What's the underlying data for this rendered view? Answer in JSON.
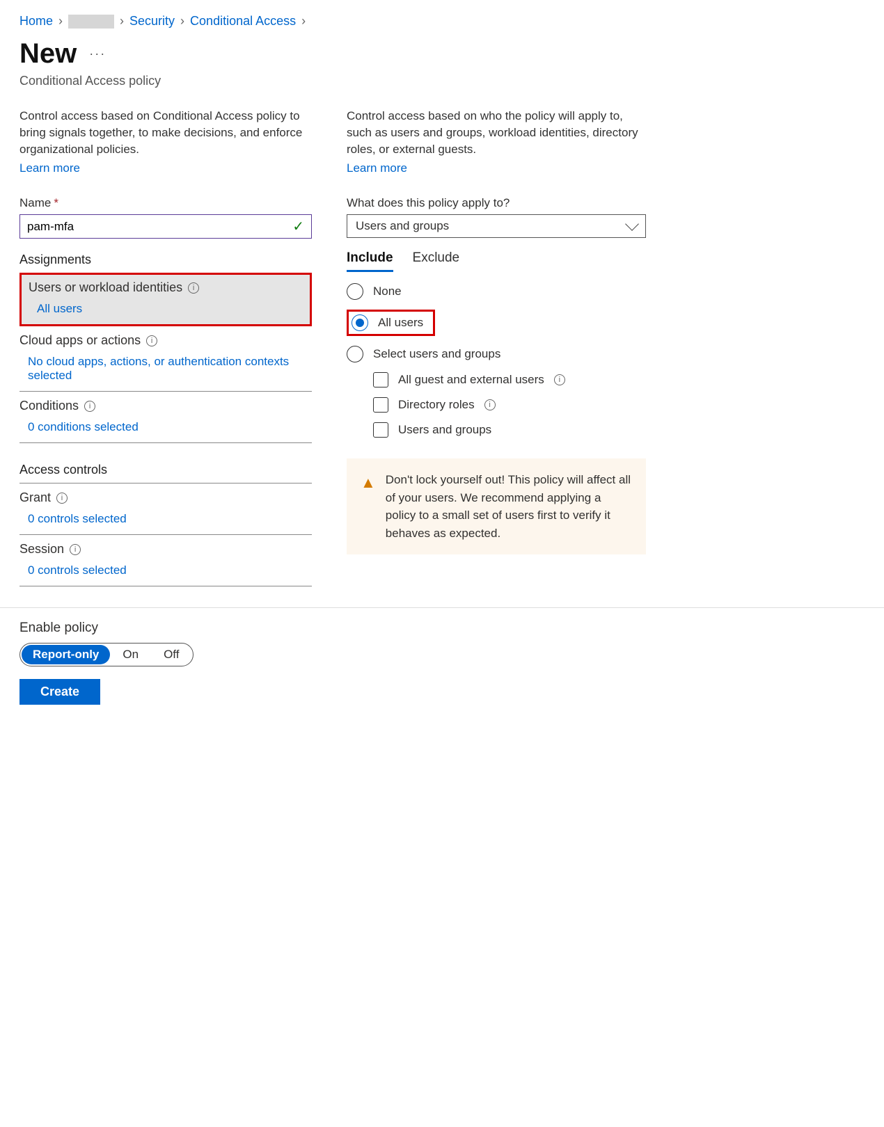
{
  "breadcrumb": {
    "items": [
      "Home",
      "",
      "Security",
      "Conditional Access"
    ]
  },
  "header": {
    "title": "New",
    "subtitle": "Conditional Access policy"
  },
  "left": {
    "description": "Control access based on Conditional Access policy to bring signals together, to make decisions, and enforce organizational policies.",
    "learn_more": "Learn more",
    "name_label": "Name",
    "name_value": "pam-mfa",
    "assignments_heading": "Assignments",
    "sections": {
      "users": {
        "title": "Users or workload identities",
        "value": "All users"
      },
      "apps": {
        "title": "Cloud apps or actions",
        "value": "No cloud apps, actions, or authentication contexts selected"
      },
      "conditions": {
        "title": "Conditions",
        "value": "0 conditions selected"
      }
    },
    "access_heading": "Access controls",
    "access": {
      "grant": {
        "title": "Grant",
        "value": "0 controls selected"
      },
      "session": {
        "title": "Session",
        "value": "0 controls selected"
      }
    }
  },
  "right": {
    "description": "Control access based on who the policy will apply to, such as users and groups, workload identities, directory roles, or external guests.",
    "learn_more": "Learn more",
    "apply_label": "What does this policy apply to?",
    "apply_select": "Users and groups",
    "tabs": {
      "include": "Include",
      "exclude": "Exclude"
    },
    "radios": {
      "none": "None",
      "all": "All users",
      "select": "Select users and groups"
    },
    "checks": {
      "guests": "All guest and external users",
      "roles": "Directory roles",
      "ug": "Users and groups"
    },
    "warning": "Don't lock yourself out! This policy will affect all of your users. We recommend applying a policy to a small set of users first to verify it behaves as expected."
  },
  "footer": {
    "enable_label": "Enable policy",
    "options": {
      "report": "Report-only",
      "on": "On",
      "off": "Off"
    },
    "create": "Create"
  }
}
